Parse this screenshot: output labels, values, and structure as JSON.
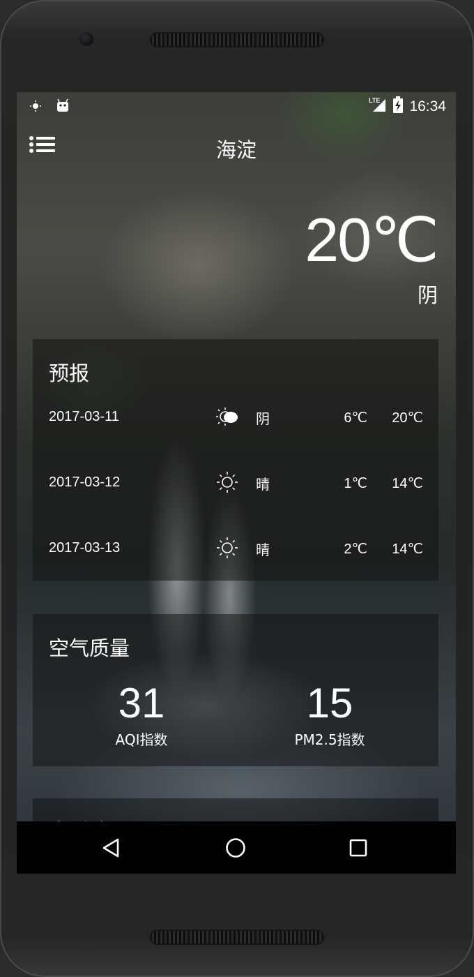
{
  "status_bar": {
    "time": "16:34",
    "network": "LTE",
    "icons": [
      "weather-notification-icon",
      "android-icon",
      "signal-icon",
      "battery-charging-icon"
    ]
  },
  "toolbar": {
    "title": "海淀",
    "menu_icon": "menu-icon"
  },
  "current": {
    "temperature": "20℃",
    "condition": "阴"
  },
  "forecast": {
    "title": "预报",
    "days": [
      {
        "date": "2017-03-11",
        "icon": "cloudy-icon",
        "condition": "阴",
        "low": "6℃",
        "high": "20℃"
      },
      {
        "date": "2017-03-12",
        "icon": "sunny-icon",
        "condition": "晴",
        "low": "1℃",
        "high": "14℃"
      },
      {
        "date": "2017-03-13",
        "icon": "sunny-icon",
        "condition": "晴",
        "low": "2℃",
        "high": "14℃"
      }
    ]
  },
  "air_quality": {
    "title": "空气质量",
    "aqi": {
      "value": "31",
      "label": "AQI指数"
    },
    "pm25": {
      "value": "15",
      "label": "PM2.5指数"
    }
  },
  "lifestyle": {
    "title": "生活建议"
  },
  "nav_bar": {
    "buttons": [
      "back-icon",
      "home-icon",
      "recents-icon"
    ]
  }
}
